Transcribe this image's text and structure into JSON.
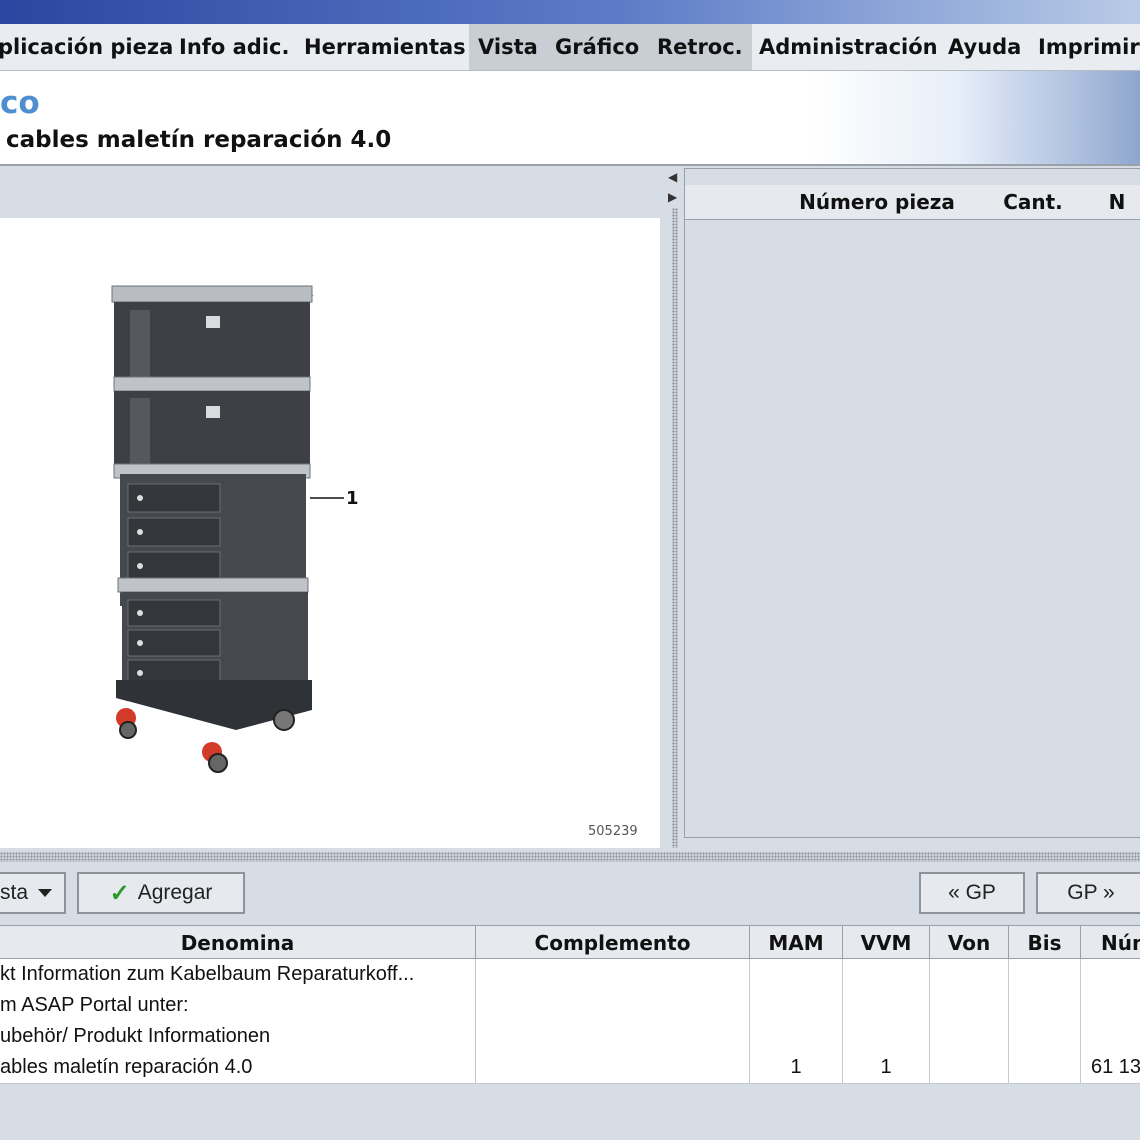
{
  "menu": {
    "items": [
      "plicación pieza",
      "Info adic.",
      "Herramientas",
      "Vista",
      "Gráfico",
      "Retroc.",
      "Administración",
      "Ayuda",
      "Imprimir"
    ]
  },
  "header": {
    "title": "co",
    "subtitle": "cables maletín reparación 4.0"
  },
  "graphic": {
    "callout_number": "1",
    "image_code": "505239"
  },
  "parts_list": {
    "columns": [
      "",
      "",
      "",
      "Número pieza",
      "Cant.",
      "N"
    ]
  },
  "toolbar": {
    "list_dropdown_label": "sta",
    "add_label": "Agregar",
    "prev_gp_label": "« GP",
    "next_gp_label": "GP »"
  },
  "table": {
    "columns": [
      "Denomina",
      "Complemento",
      "MAM",
      "VVM",
      "Von",
      "Bis",
      "Núm"
    ],
    "rows": [
      {
        "denomina": "kt Information zum Kabelbaum Reparaturkoff...",
        "complemento": "",
        "mam": "",
        "vvm": "",
        "von": "",
        "bis": "",
        "num": ""
      },
      {
        "denomina": "m ASAP Portal unter:",
        "complemento": "",
        "mam": "",
        "vvm": "",
        "von": "",
        "bis": "",
        "num": ""
      },
      {
        "denomina": "ubehör/ Produkt Informationen",
        "complemento": "",
        "mam": "",
        "vvm": "",
        "von": "",
        "bis": "",
        "num": ""
      },
      {
        "denomina": "ables maletín reparación 4.0",
        "complemento": "",
        "mam": "1",
        "vvm": "1",
        "von": "",
        "bis": "",
        "num": "61 13"
      }
    ]
  },
  "colors": {
    "title_accent": "#4f8fd0",
    "check_green": "#2b9a2b",
    "caster_red": "#d43a2a"
  }
}
